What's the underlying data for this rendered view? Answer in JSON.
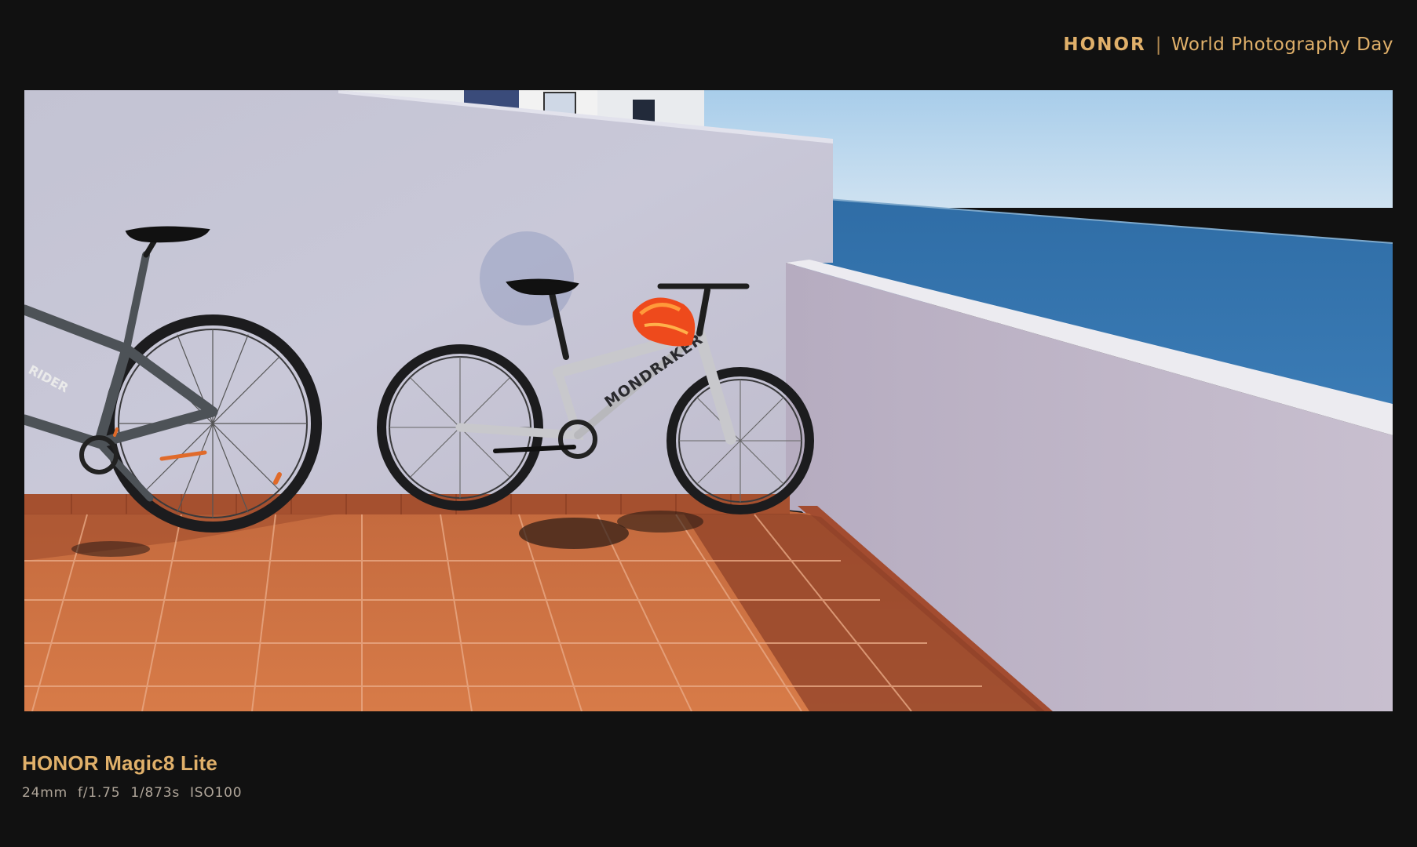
{
  "header": {
    "brand": "HONOR",
    "separator": "|",
    "event": "World Photography Day"
  },
  "photo": {
    "subject": "two mountain bikes leaning against a white rooftop terrace wall above the sea",
    "bike_frame_text": "MONDRAKER",
    "left_bike_frame_text": "RIDER"
  },
  "footer": {
    "device": "HONOR Magic8 Lite",
    "exif": {
      "focal_length": "24mm",
      "aperture": "f/1.75",
      "shutter": "1/873s",
      "iso": "ISO100"
    }
  },
  "colors": {
    "background": "#111111",
    "accent": "#e0b06a",
    "exif_text": "#b0a69a"
  }
}
